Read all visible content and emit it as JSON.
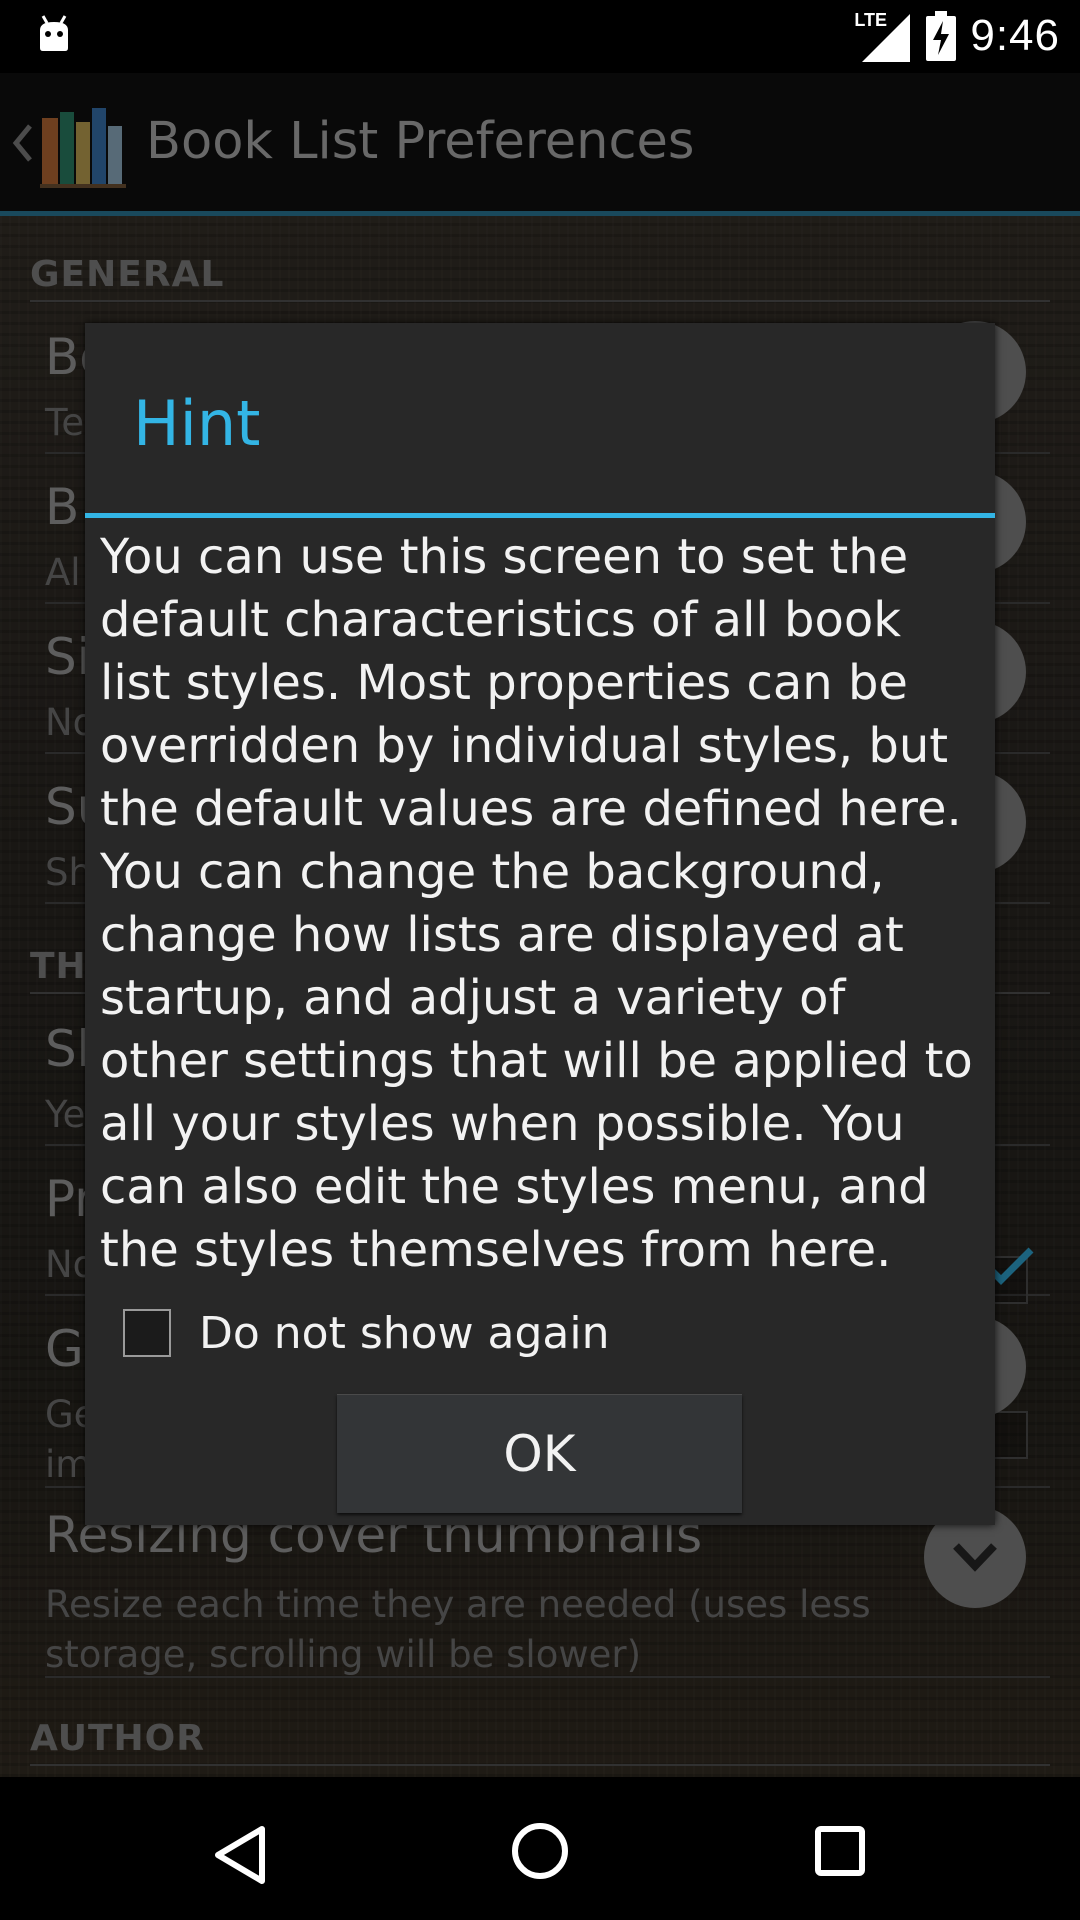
{
  "status_bar": {
    "time": "9:46",
    "network_label": "LTE",
    "icons": [
      "android-notification-icon",
      "lte-signal-icon",
      "battery-charging-icon"
    ]
  },
  "action_bar": {
    "title": "Book List Preferences",
    "icons": [
      "up-caret-icon",
      "bookshelf-logo-icon"
    ]
  },
  "background_list": {
    "categories": [
      "GENERAL",
      "TH",
      "AUTHOR"
    ],
    "items": [
      {
        "title": "Bo",
        "summary": "Te"
      },
      {
        "title": "B",
        "summary": "Al"
      },
      {
        "title": "Si",
        "summary": "No"
      },
      {
        "title": "Su",
        "summary": "Sh"
      },
      {
        "title": "Sh",
        "summary": "Ye"
      },
      {
        "title": "Pr",
        "summary": "No"
      },
      {
        "title": "G",
        "summary": "Ge\nim"
      },
      {
        "title": "Resizing cover thumbnails",
        "summary": "Resize each time they are needed (uses less storage, scrolling will be slower)"
      }
    ]
  },
  "dialog": {
    "title": "Hint",
    "message": "You can use this screen to set the default characteristics of all book list styles. Most properties can be overridden by individual styles, but the default values are defined here. You can change the background, change how lists are displayed at startup, and adjust a variety of other settings that will be applied to all your styles when possible. You can also edit the styles menu, and the styles themselves from here.",
    "checkbox_label": "Do not show again",
    "checkbox_checked": false,
    "ok_label": "OK"
  },
  "nav_bar": {
    "buttons": [
      "back-icon",
      "home-icon",
      "recents-icon"
    ]
  },
  "colors": {
    "accent": "#33b5e5",
    "action_bar_line": "#2e86a8",
    "dialog_bg": "#282828"
  }
}
